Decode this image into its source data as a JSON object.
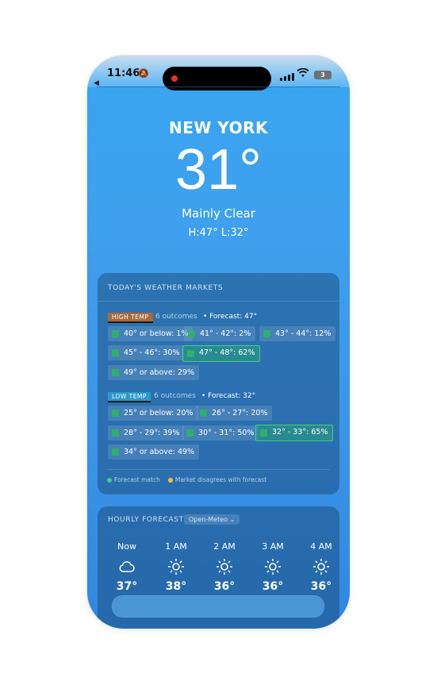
{
  "status": {
    "time": "11:46",
    "battery": "3"
  },
  "current": {
    "city": "NEW YORK",
    "temp": "31°",
    "condition": "Mainly Clear",
    "hilo": "H:47° L:32°"
  },
  "markets": {
    "title": "TODAY'S WEATHER MARKETS",
    "high": {
      "tag": "HIGH TEMP",
      "outcomes": "6 outcomes",
      "forecast": "• Forecast: 47°",
      "chips": [
        "40° or below: 1%",
        "41° - 42°: 2%",
        "43° - 44°: 12%",
        "45° - 46°: 30%",
        "47° - 48°: 62%",
        "49° or above: 29%"
      ]
    },
    "low": {
      "tag": "LOW TEMP",
      "outcomes": "6 outcomes",
      "forecast": "• Forecast: 32°",
      "chips": [
        "25° or below: 20%",
        "26° - 27°: 20%",
        "28° - 29°: 39%",
        "30° - 31°: 50%",
        "32° - 33°: 65%",
        "34° or above: 49%"
      ]
    },
    "legend": {
      "match": "Forecast match",
      "disagree": "Market disagrees with forecast",
      "match_color": "#3fd08a",
      "disagree_color": "#f0c23a"
    }
  },
  "hourly": {
    "title": "HOURLY FORECAST",
    "source": "Open-Meteo",
    "items": [
      {
        "label": "Now",
        "icon": "cloud-icon",
        "temp": "37°"
      },
      {
        "label": "1 AM",
        "icon": "sun-icon",
        "temp": "38°"
      },
      {
        "label": "2 AM",
        "icon": "sun-icon",
        "temp": "36°"
      },
      {
        "label": "3 AM",
        "icon": "sun-icon",
        "temp": "36°"
      },
      {
        "label": "4 AM",
        "icon": "sun-icon",
        "temp": "36°"
      }
    ]
  }
}
